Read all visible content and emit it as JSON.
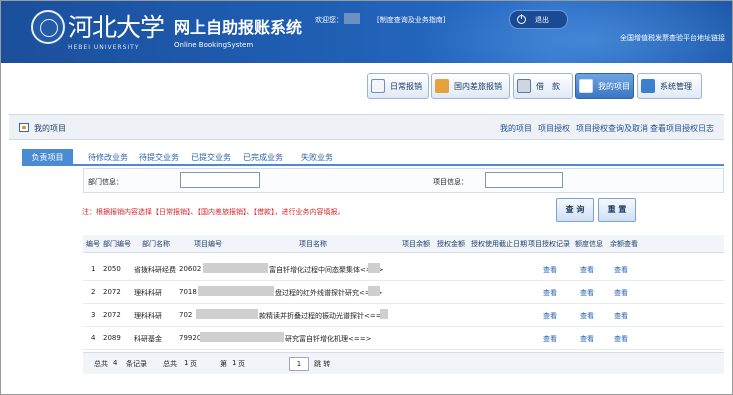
{
  "header": {
    "logo_name": "河北大学",
    "logo_en": "HEBEI UNIVERSITY",
    "system_title": "网上自助报账系统",
    "system_subtitle": "Online BookingSystem",
    "welcome": "欢迎您：",
    "help_link": "[制度查询及业务指南]",
    "logout": "退出",
    "platform_link": "全国增值税发票查验平台地址链接"
  },
  "nav": [
    {
      "label": "日常报销",
      "icon": "daily-reimbursement-icon"
    },
    {
      "label": "国内差旅报销",
      "icon": "travel-icon"
    },
    {
      "label": "借　款",
      "icon": "loan-icon"
    },
    {
      "label": "我的项目",
      "icon": "my-project-icon",
      "active": true
    },
    {
      "label": "系统管理",
      "icon": "system-icon"
    }
  ],
  "page": {
    "title": "我的项目",
    "links": [
      "我的项目",
      "项目授权",
      "项目授权查询及取消",
      "查看项目授权日志"
    ]
  },
  "tabs": [
    "负责项目",
    "待修改业务",
    "待提交业务",
    "已提交业务",
    "已完成业务",
    "失败业务"
  ],
  "search": {
    "dept_label": "部门信息：",
    "project_label": "项目信息：",
    "dept_value": "",
    "project_value": ""
  },
  "notice": "注：根据报销内容选择【日常报销】、【国内差旅报销】、【借款】，进行业务内容填报。",
  "buttons": {
    "query": "查 询",
    "reset": "重 置"
  },
  "table": {
    "headers": [
      "编号",
      "部门编号",
      "部门名称",
      "项目编号",
      "项目名称",
      "项目余额",
      "授权金额",
      "授权使用截止日期",
      "项目授权记录",
      "额度信息",
      "余额查看"
    ],
    "rows": [
      {
        "no": "1",
        "dept_no": "2050",
        "dept_name": "省拨科研经费",
        "proj_no": "20602",
        "proj_name": "富自钎增化过程中间态聚集体<==>",
        "rec": "查看",
        "quota": "查看",
        "bal": "查看"
      },
      {
        "no": "2",
        "dept_no": "2072",
        "dept_name": "理科科研",
        "proj_no": "7018",
        "proj_name": "盘过程的红外线谱探针研究<==>",
        "rec": "查看",
        "quota": "查看",
        "bal": "查看"
      },
      {
        "no": "3",
        "dept_no": "2072",
        "dept_name": "理科科研",
        "proj_no": "702",
        "proj_name": "款精读并折叠过程的振动光谱探针<==>",
        "rec": "查看",
        "quota": "查看",
        "bal": "查看"
      },
      {
        "no": "4",
        "dept_no": "2089",
        "dept_name": "科研基金",
        "proj_no": "79920",
        "proj_name": "研究富自钎增化机理<==>",
        "rec": "查看",
        "quota": "查看",
        "bal": "查看"
      }
    ]
  },
  "footer": {
    "total": "总共",
    "total_count": "4",
    "records": "条记录",
    "total_pages_prefix": "总共",
    "total_pages": "1",
    "pages_suffix": "页",
    "current_prefix": "第",
    "current": "1",
    "current_suffix": "页",
    "page_input": "1",
    "jump": "跳 转"
  }
}
